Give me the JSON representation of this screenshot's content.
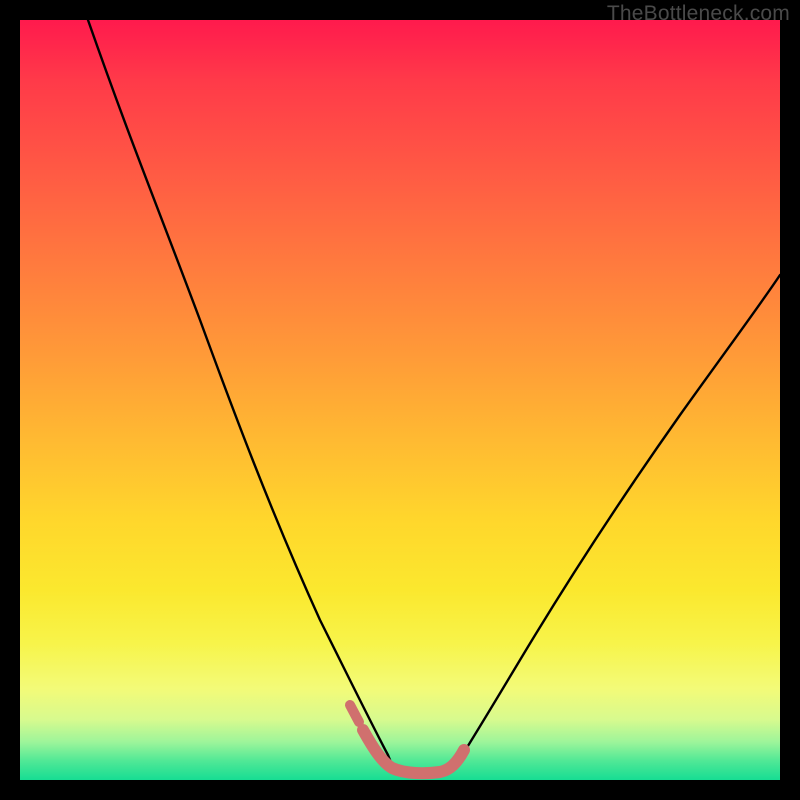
{
  "watermark": "TheBottleneck.com",
  "chart_data": {
    "type": "line",
    "title": "",
    "xlabel": "",
    "ylabel": "",
    "xlim": [
      0,
      100
    ],
    "ylim": [
      0,
      100
    ],
    "series": [
      {
        "name": "left-curve",
        "x": [
          9,
          18,
          27,
          36,
          40,
          44,
          47,
          49
        ],
        "y": [
          100,
          81,
          59,
          35,
          23,
          12,
          5,
          2
        ]
      },
      {
        "name": "right-curve",
        "x": [
          57,
          61,
          66,
          72,
          80,
          88,
          95,
          100
        ],
        "y": [
          2,
          5,
          11,
          19,
          32,
          46,
          58,
          67
        ]
      },
      {
        "name": "highlight-bottom",
        "x": [
          45,
          47,
          49,
          52,
          54,
          56,
          58
        ],
        "y": [
          6,
          3,
          1.5,
          1,
          1,
          1.5,
          4
        ]
      }
    ],
    "colors": {
      "curve": "#000000",
      "highlight": "#d0706e",
      "gradient_top": "#ff1a4d",
      "gradient_mid": "#ffd72c",
      "gradient_bottom": "#16dd93"
    }
  }
}
